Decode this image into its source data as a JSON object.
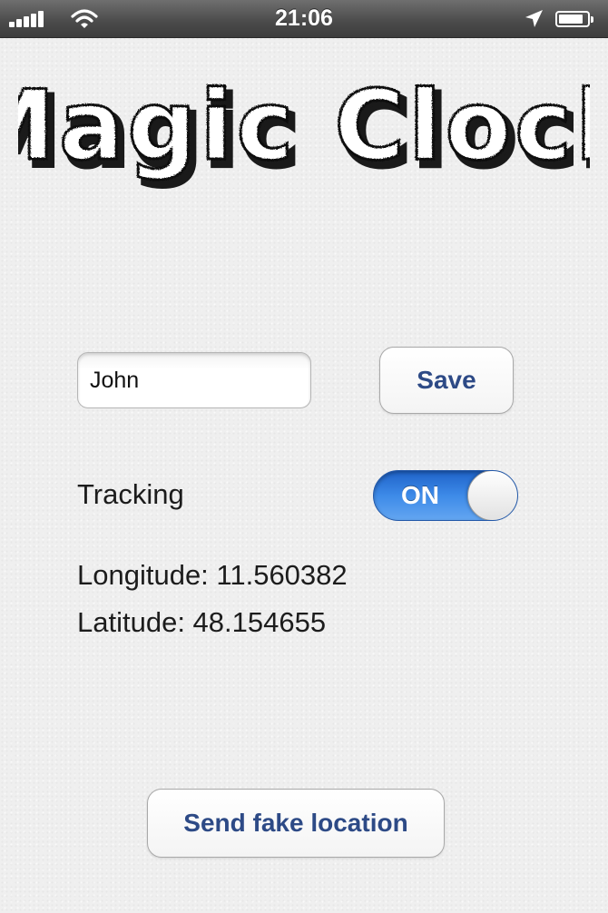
{
  "status_bar": {
    "time": "21:06",
    "battery_level": 0.85,
    "signal_bars": 5
  },
  "app": {
    "title": "Magic Clock"
  },
  "name_field": {
    "value": "John"
  },
  "save_button": {
    "label": "Save"
  },
  "tracking": {
    "label": "Tracking",
    "toggle_label": "ON",
    "enabled": true,
    "accent_color": "#3d8ae8"
  },
  "location": {
    "longitude_text": "Longitude: 11.560382",
    "latitude_text": "Latitude: 48.154655"
  },
  "fake_location_button": {
    "label": "Send fake location"
  },
  "colors": {
    "button_text": "#2d4a86",
    "background": "#efefef",
    "status_bar": "#4a4a4a"
  },
  "icons": [
    "signal-icon",
    "wifi-icon",
    "location-arrow-icon",
    "battery-icon"
  ]
}
